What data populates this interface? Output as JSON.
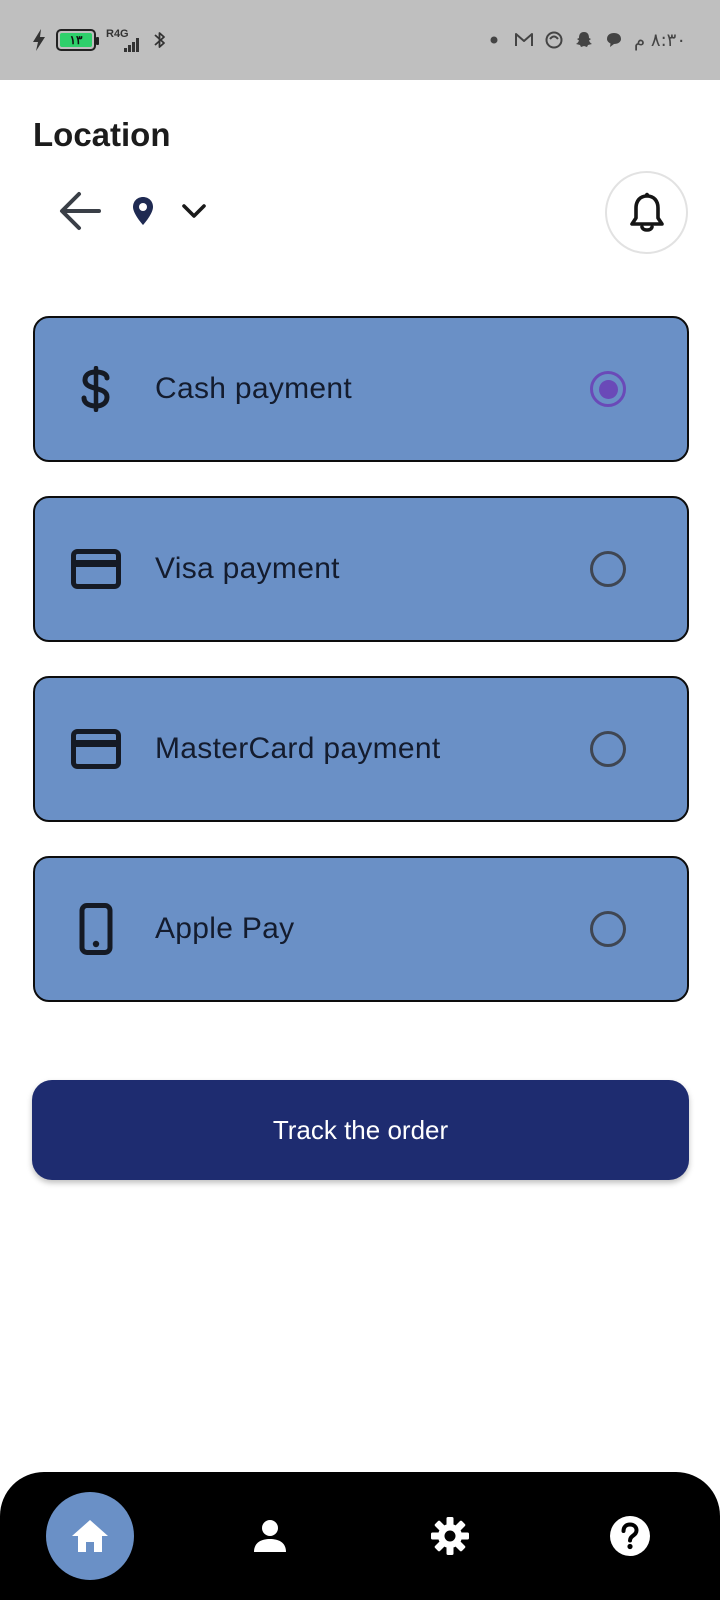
{
  "status_bar": {
    "battery_level": "١٣",
    "network": "R4G",
    "time": "٨:٣٠ م"
  },
  "header": {
    "title": "Location"
  },
  "payment_methods": [
    {
      "label": "Cash payment",
      "icon": "dollar-icon",
      "selected": true
    },
    {
      "label": "Visa payment",
      "icon": "credit-card-icon",
      "selected": false
    },
    {
      "label": "MasterCard payment",
      "icon": "credit-card-icon",
      "selected": false
    },
    {
      "label": "Apple Pay",
      "icon": "smartphone-icon",
      "selected": false
    }
  ],
  "track_button": {
    "label": "Track the order"
  },
  "bottom_nav": {
    "items": [
      {
        "icon": "home-icon",
        "active": true
      },
      {
        "icon": "person-icon",
        "active": false
      },
      {
        "icon": "settings-gear-icon",
        "active": false
      },
      {
        "icon": "help-icon",
        "active": false
      }
    ]
  },
  "colors": {
    "card_background": "#6a90c6",
    "radio_selected": "#6a4ab8",
    "primary_button": "#1e2c70",
    "nav_background": "#000000",
    "nav_active": "#6a90c6",
    "battery_fill": "#2ed06b"
  }
}
